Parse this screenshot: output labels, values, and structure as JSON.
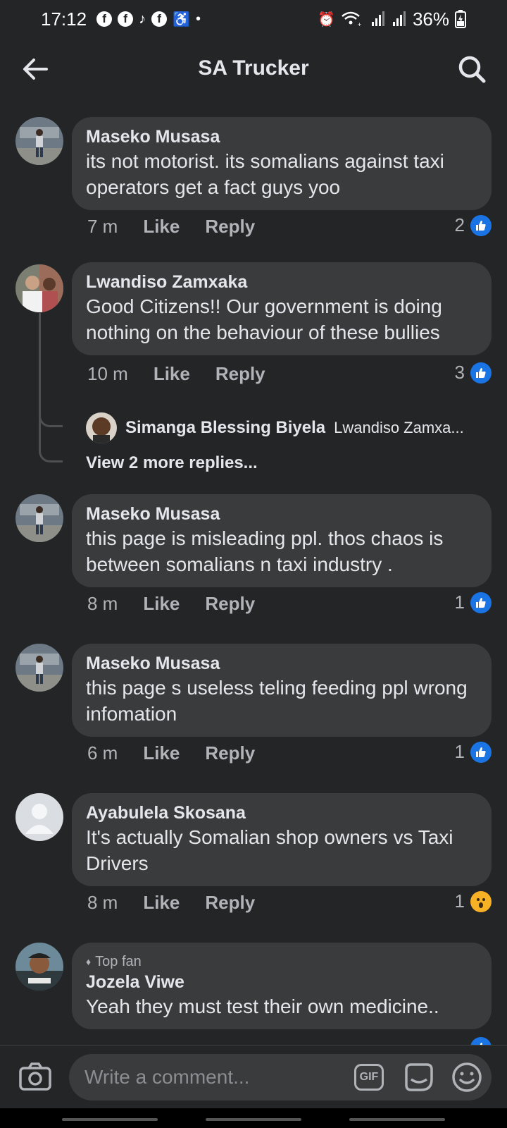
{
  "status_bar": {
    "time": "17:12",
    "battery": "36%",
    "left_icons": [
      "facebook-icon",
      "facebook-icon",
      "tiktok-icon",
      "facebook-icon",
      "accessibility-icon",
      "dot-icon"
    ],
    "right_icons": [
      "alarm-icon",
      "wifi-icon",
      "signal-icon",
      "signal-icon",
      "battery-icon"
    ]
  },
  "header": {
    "title": "SA Trucker"
  },
  "comments": [
    {
      "author": "Maseko Musasa",
      "text": "its not motorist. its somalians against taxi operators get a fact guys yoo",
      "time": "7 m",
      "like_label": "Like",
      "reply_label": "Reply",
      "reaction_count": "2",
      "reaction": "like"
    },
    {
      "author": "Lwandiso Zamxaka",
      "text": "Good Citizens!! Our government is doing nothing on the behaviour of these bullies",
      "time": "10 m",
      "like_label": "Like",
      "reply_label": "Reply",
      "reaction_count": "3",
      "reaction": "like",
      "reply_preview": {
        "author": "Simanga Blessing Biyela",
        "snippet": "Lwandiso Zamxa..."
      },
      "view_more": "View 2 more replies..."
    },
    {
      "author": "Maseko Musasa",
      "text": "this page is misleading ppl. thos chaos is between somalians n taxi industry .",
      "time": "8 m",
      "like_label": "Like",
      "reply_label": "Reply",
      "reaction_count": "1",
      "reaction": "like"
    },
    {
      "author": "Maseko Musasa",
      "text": "this page s useless teling feeding ppl wrong infomation",
      "time": "6 m",
      "like_label": "Like",
      "reply_label": "Reply",
      "reaction_count": "1",
      "reaction": "like"
    },
    {
      "author": "Ayabulela Skosana",
      "text": "It's actually Somalian shop owners vs Taxi Drivers",
      "time": "8 m",
      "like_label": "Like",
      "reply_label": "Reply",
      "reaction_count": "1",
      "reaction": "wow"
    },
    {
      "badge": "Top fan",
      "author": "Jozela Viwe",
      "text": "Yeah they must test their own medicine..",
      "reaction": "like"
    }
  ],
  "composer": {
    "placeholder": "Write a comment...",
    "gif_label": "GIF"
  },
  "colors": {
    "background": "#242526",
    "bubble": "#3a3b3c",
    "like_blue": "#1b74e4",
    "wow_yellow": "#f7b125",
    "muted_text": "#b0b3b8"
  }
}
